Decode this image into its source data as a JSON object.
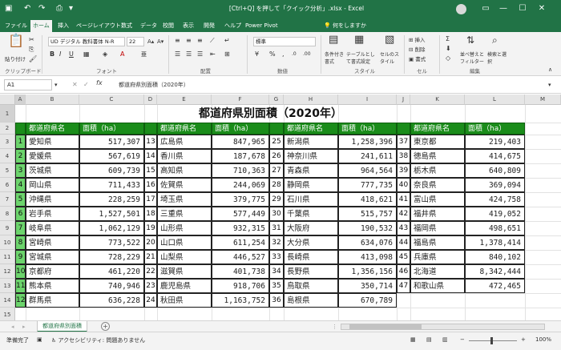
{
  "window": {
    "title": "[Ctrl+Q] を押して「クイック分析」.xlsx - Excel"
  },
  "ribbon_tabs": [
    "ファイル",
    "ホーム",
    "挿入",
    "ページレイアウト",
    "数式",
    "データ",
    "校閲",
    "表示",
    "開発",
    "ヘルプ",
    "Power Pivot"
  ],
  "active_tab": "ホーム",
  "tell_me": "何をしますか",
  "ribbon": {
    "clipboard_label": "クリップボード",
    "paste_label": "貼り付け",
    "font_label": "フォント",
    "font_name": "UD デジタル 教科書体 N-R",
    "font_size": "22",
    "alignment_label": "配置",
    "number_label": "数値",
    "number_format": "標準",
    "styles_label": "スタイル",
    "cond_format": "条件付き書式",
    "table_format": "テーブルとして書式設定",
    "cell_style": "セルのスタイル",
    "cells_label": "セル",
    "insert": "挿入",
    "delete": "削除",
    "format": "書式",
    "editing_label": "編集",
    "sort_filter": "並べ替えとフィルター",
    "find_select": "検索と選択"
  },
  "formula_bar": {
    "name_box": "A1",
    "fx": "fx",
    "formula": "都道府県別面積（2020年）"
  },
  "columns": [
    "A",
    "B",
    "C",
    "D",
    "E",
    "F",
    "G",
    "H",
    "I",
    "J",
    "K",
    "L",
    "M"
  ],
  "rows": [
    "1",
    "2",
    "3",
    "4",
    "5",
    "6",
    "7",
    "8",
    "9",
    "10",
    "11",
    "12",
    "13",
    "14",
    "15",
    "16",
    "17",
    "18"
  ],
  "sheet": {
    "title": "都道府県別面積（2020年）",
    "header_pref": "都道府県名",
    "header_area": "面積（ha）",
    "blocks": [
      [
        {
          "n": "1",
          "p": "愛知県",
          "a": "517,307"
        },
        {
          "n": "2",
          "p": "愛媛県",
          "a": "567,619"
        },
        {
          "n": "3",
          "p": "茨城県",
          "a": "609,739"
        },
        {
          "n": "4",
          "p": "岡山県",
          "a": "711,433"
        },
        {
          "n": "5",
          "p": "沖縄県",
          "a": "228,259"
        },
        {
          "n": "6",
          "p": "岩手県",
          "a": "1,527,501"
        },
        {
          "n": "7",
          "p": "岐阜県",
          "a": "1,062,129"
        },
        {
          "n": "8",
          "p": "宮崎県",
          "a": "773,522"
        },
        {
          "n": "9",
          "p": "宮城県",
          "a": "728,229"
        },
        {
          "n": "10",
          "p": "京都府",
          "a": "461,220"
        },
        {
          "n": "11",
          "p": "熊本県",
          "a": "740,946"
        },
        {
          "n": "12",
          "p": "群馬県",
          "a": "636,228"
        }
      ],
      [
        {
          "n": "13",
          "p": "広島県",
          "a": "847,965"
        },
        {
          "n": "14",
          "p": "香川県",
          "a": "187,678"
        },
        {
          "n": "15",
          "p": "高知県",
          "a": "710,363"
        },
        {
          "n": "16",
          "p": "佐賀県",
          "a": "244,069"
        },
        {
          "n": "17",
          "p": "埼玉県",
          "a": "379,775"
        },
        {
          "n": "18",
          "p": "三重県",
          "a": "577,449"
        },
        {
          "n": "19",
          "p": "山形県",
          "a": "932,315"
        },
        {
          "n": "20",
          "p": "山口県",
          "a": "611,254"
        },
        {
          "n": "21",
          "p": "山梨県",
          "a": "446,527"
        },
        {
          "n": "22",
          "p": "滋賀県",
          "a": "401,738"
        },
        {
          "n": "23",
          "p": "鹿児島県",
          "a": "918,706"
        },
        {
          "n": "24",
          "p": "秋田県",
          "a": "1,163,752"
        }
      ],
      [
        {
          "n": "25",
          "p": "新潟県",
          "a": "1,258,396"
        },
        {
          "n": "26",
          "p": "神奈川県",
          "a": "241,611"
        },
        {
          "n": "27",
          "p": "青森県",
          "a": "964,564"
        },
        {
          "n": "28",
          "p": "静岡県",
          "a": "777,735"
        },
        {
          "n": "29",
          "p": "石川県",
          "a": "418,621"
        },
        {
          "n": "30",
          "p": "千葉県",
          "a": "515,757"
        },
        {
          "n": "31",
          "p": "大阪府",
          "a": "190,532"
        },
        {
          "n": "32",
          "p": "大分県",
          "a": "634,076"
        },
        {
          "n": "33",
          "p": "長崎県",
          "a": "413,098"
        },
        {
          "n": "34",
          "p": "長野県",
          "a": "1,356,156"
        },
        {
          "n": "35",
          "p": "鳥取県",
          "a": "350,714"
        },
        {
          "n": "36",
          "p": "島根県",
          "a": "670,789"
        }
      ],
      [
        {
          "n": "37",
          "p": "東京都",
          "a": "219,403"
        },
        {
          "n": "38",
          "p": "徳島県",
          "a": "414,675"
        },
        {
          "n": "39",
          "p": "栃木県",
          "a": "640,809"
        },
        {
          "n": "40",
          "p": "奈良県",
          "a": "369,094"
        },
        {
          "n": "41",
          "p": "富山県",
          "a": "424,758"
        },
        {
          "n": "42",
          "p": "福井県",
          "a": "419,052"
        },
        {
          "n": "43",
          "p": "福岡県",
          "a": "498,651"
        },
        {
          "n": "44",
          "p": "福島県",
          "a": "1,378,414"
        },
        {
          "n": "45",
          "p": "兵庫県",
          "a": "840,102"
        },
        {
          "n": "46",
          "p": "北海道",
          "a": "8,342,444"
        },
        {
          "n": "47",
          "p": "和歌山県",
          "a": "472,465"
        }
      ]
    ]
  },
  "sheet_tab": "都道府県別面積",
  "status": {
    "ready": "準備完了",
    "accessibility": "アクセシビリティ: 問題ありません",
    "zoom": "100%"
  },
  "colors": {
    "excel_green": "#217346",
    "header_green": "#1a8c1a",
    "number_green": "#6cd46c"
  }
}
